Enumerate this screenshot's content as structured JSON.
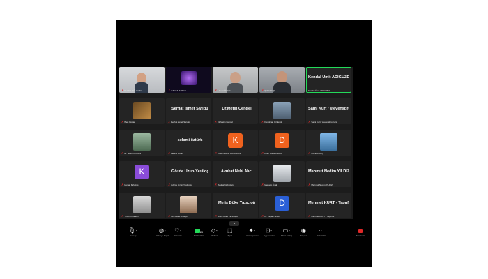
{
  "participants": [
    {
      "name": "Dr.Hilal OĞULCAN",
      "caption": "Dr.Hilal OĞULCAN"
    },
    {
      "name": "CANAN ERKAN",
      "caption": "CANAN ERKAN"
    },
    {
      "name": "Hasan Öztürk",
      "caption": "Hasan Öztürk"
    },
    {
      "name": "Şahin Dağlı",
      "caption": "Şahin Dağlı"
    },
    {
      "name": "Kendal Ümit ADIGÜZEL",
      "caption": "Kendal Ümit ADIGÜZEL"
    },
    {
      "name": "Mert Doğan",
      "caption": "Mert Doğan"
    },
    {
      "name": "Serhat İsmet Sarıgül",
      "caption": "Serhat İsmet Sarıgül"
    },
    {
      "name": "Dr.Metin Çengel",
      "caption": "Dr.Metin Çengel"
    },
    {
      "name": "Demircan Özdemir",
      "caption": "Demircan Özdemir"
    },
    {
      "name": "Sami Kurt / stevensbrothers",
      "caption": "Sami Kurt / stevensbrothers"
    },
    {
      "name": "Dr. Nevin AKMAN",
      "caption": "Dr. Nevin AKMAN"
    },
    {
      "name": "selami öztürk",
      "caption": "selami öztürk"
    },
    {
      "name": "Kaan Nusret KOCAMAN",
      "caption": "Kaan Nusret KOCAMAN"
    },
    {
      "name": "Dilan Damla ARAS",
      "caption": "Dilan Damla ARAS"
    },
    {
      "name": "Murat KORÇ",
      "caption": "Murat KORÇ"
    },
    {
      "name": "Kemal Kırkızaş",
      "caption": "Kemal Kırkızaş"
    },
    {
      "name": "Gözde Uzun-Yesiloglu",
      "caption": "Gözde Uzun-Yesiloglu"
    },
    {
      "name": "Avukat Nebi Alıcı",
      "caption": "Avukat Nebi Alıcı"
    },
    {
      "name": "Meryem Ünal",
      "caption": "Meryem Ünal"
    },
    {
      "name": "Mahmut Nedim YILDIZ",
      "caption": "Mahmut Nedim YILDIZ"
    },
    {
      "name": "Yıldırım Kalkan",
      "caption": "Yıldırım Kalkan"
    },
    {
      "name": "Ali Nusret Andaçlı",
      "caption": "Ali Nusret Andaçlı"
    },
    {
      "name": "Melis Böke Yazıcıoğlu",
      "caption": "Melis Böke Yazıcıoğlu"
    },
    {
      "name": "Dr. Leyla Turhan",
      "caption": "Dr. Leyla Turhan"
    },
    {
      "name": "Mehmet KURT - Tapuflat",
      "caption": "Mehmet KURT - Tapuflat"
    }
  ],
  "avatars": {
    "k1": "K",
    "d1": "D",
    "k2": "K",
    "d2": "D"
  },
  "toolbar": {
    "audio": "Sesi aç",
    "video": "Videoyu başlat",
    "security": "Güvenlik",
    "participants": "Katılımcılar",
    "participants_count": "25",
    "chat": "Sohbet",
    "react": "Tepki",
    "share": "Ekran paylaş",
    "host_tools": "Ana bilgisayar araçları",
    "ai": "AI Companion",
    "apps": "Uygulamalar",
    "whiteboard": "Beyaz tahtalar",
    "record": "Kaydet",
    "more": "Daha fazla",
    "end": "Sonlandır"
  },
  "colors": {
    "active_speaker": "#23d959",
    "muted_mic": "#e02828",
    "avatar_orange": "#f0621e",
    "avatar_purple": "#8a4cd9",
    "avatar_blue": "#2a5fd6"
  }
}
